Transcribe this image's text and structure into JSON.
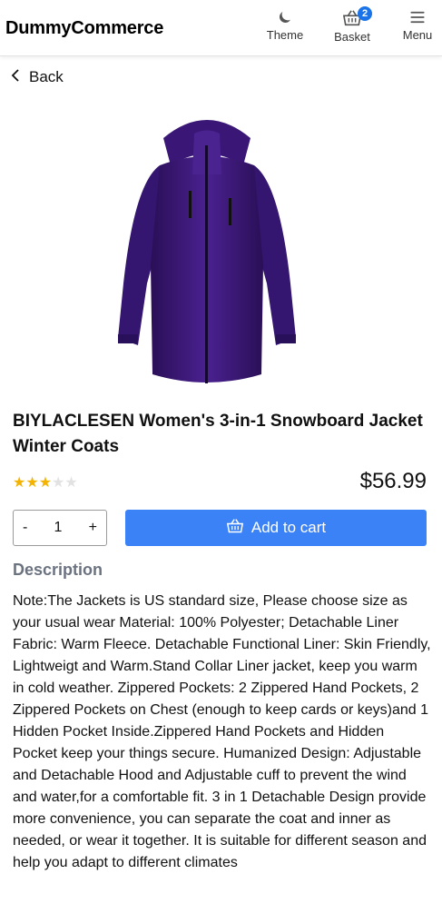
{
  "header": {
    "brand": "DummyCommerce",
    "theme_label": "Theme",
    "basket_label": "Basket",
    "basket_count": "2",
    "menu_label": "Menu"
  },
  "nav": {
    "back_label": "Back"
  },
  "product": {
    "title": "BIYLACLESEN Women's 3-in-1 Snowboard Jacket Winter Coats",
    "rating": 3,
    "rating_max": 5,
    "price": "$56.99",
    "image_name": "purple-jacket-image",
    "image_color": "#3a1a6e"
  },
  "cart": {
    "quantity": "1",
    "decrement_label": "-",
    "increment_label": "+",
    "add_to_cart_label": "Add to cart",
    "button_color": "#3b82f6"
  },
  "description": {
    "heading": "Description",
    "text": "Note:The Jackets is US standard size, Please choose size as your usual wear Material: 100% Polyester; Detachable Liner Fabric: Warm Fleece. Detachable Functional Liner: Skin Friendly, Lightweigt and Warm.Stand Collar Liner jacket, keep you warm in cold weather. Zippered Pockets: 2 Zippered Hand Pockets, 2 Zippered Pockets on Chest (enough to keep cards or keys)and 1 Hidden Pocket Inside.Zippered Hand Pockets and Hidden Pocket keep your things secure. Humanized Design: Adjustable and Detachable Hood and Adjustable cuff to prevent the wind and water,for a comfortable fit. 3 in 1 Detachable Design provide more convenience, you can separate the coat and inner as needed, or wear it together. It is suitable for different season and help you adapt to different climates"
  }
}
